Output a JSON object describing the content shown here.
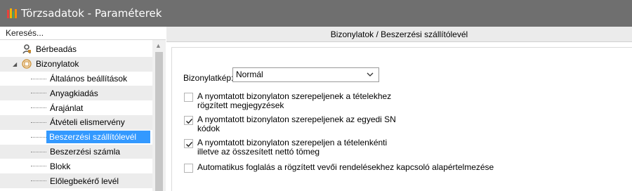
{
  "window": {
    "title": "Törzsadatok - Paraméterek"
  },
  "search": {
    "placeholder": "Keresés..."
  },
  "tree": {
    "items": [
      {
        "label": "Bérbeadás",
        "level": 1,
        "icon": "key-icon"
      },
      {
        "label": "Bizonylatok",
        "level": 1,
        "icon": "documents-icon",
        "expanded": true
      },
      {
        "label": "Általános beállítások",
        "level": 2
      },
      {
        "label": "Anyagkiadás",
        "level": 2
      },
      {
        "label": "Árajánlat",
        "level": 2
      },
      {
        "label": "Átvételi elismervény",
        "level": 2
      },
      {
        "label": "Beszerzési szállítólevél",
        "level": 2,
        "selected": true
      },
      {
        "label": "Beszerzési számla",
        "level": 2
      },
      {
        "label": "Blokk",
        "level": 2
      },
      {
        "label": "Előlegbekérő levél",
        "level": 2
      }
    ]
  },
  "panel": {
    "header": "Bizonylatok / Beszerzési szállítólevél",
    "doc_image_label": "Bizonylatkép:",
    "doc_image_value": "Normál",
    "checkboxes": [
      {
        "line1": "A nyomtatott bizonylaton szerepeljenek a tételekhez",
        "line2": "rögzített megjegyzések",
        "checked": false
      },
      {
        "line1": "A nyomtatott bizonylaton szerepeljenek az egyedi SN",
        "line2": "kódok",
        "checked": true
      },
      {
        "line1": "A nyomtatott bizonylaton szerepeljen a tételenkénti",
        "line2": "illetve az összesített nettó tömeg",
        "checked": true
      },
      {
        "line1": "Automatikus foglalás a rögzített vevői rendelésekhez kapcsoló alapértelmezése",
        "line2": "",
        "checked": false
      }
    ]
  },
  "colors": {
    "titlebar": "#6f6f6f",
    "selection": "#3399ff",
    "alt_row": "#ececec"
  }
}
